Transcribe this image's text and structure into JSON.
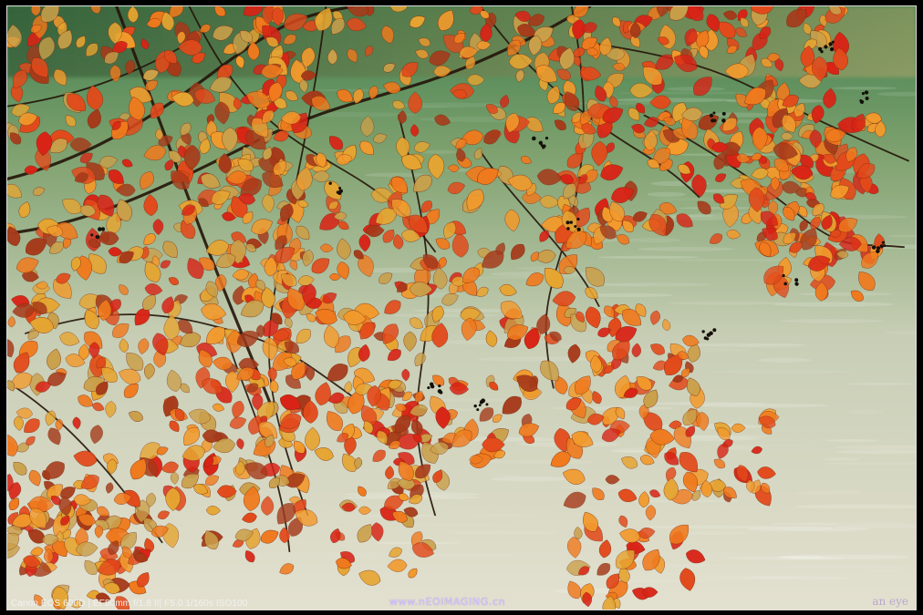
{
  "image": {
    "description_colors": {
      "water_top": "#4f8a54",
      "water_bottom": "#d9d8c8",
      "leaf_red": "#d92316",
      "leaf_orange": "#f07a1d",
      "leaf_yellow": "#e6a531",
      "branch": "#241409"
    }
  },
  "watermarks": {
    "camera_exif": "Canon EOS 600D  | EF50mm f/1.8 II| F5.0 1/160s ISO100",
    "website": "www.nEOiMAGING.cn",
    "author": "an eye"
  }
}
